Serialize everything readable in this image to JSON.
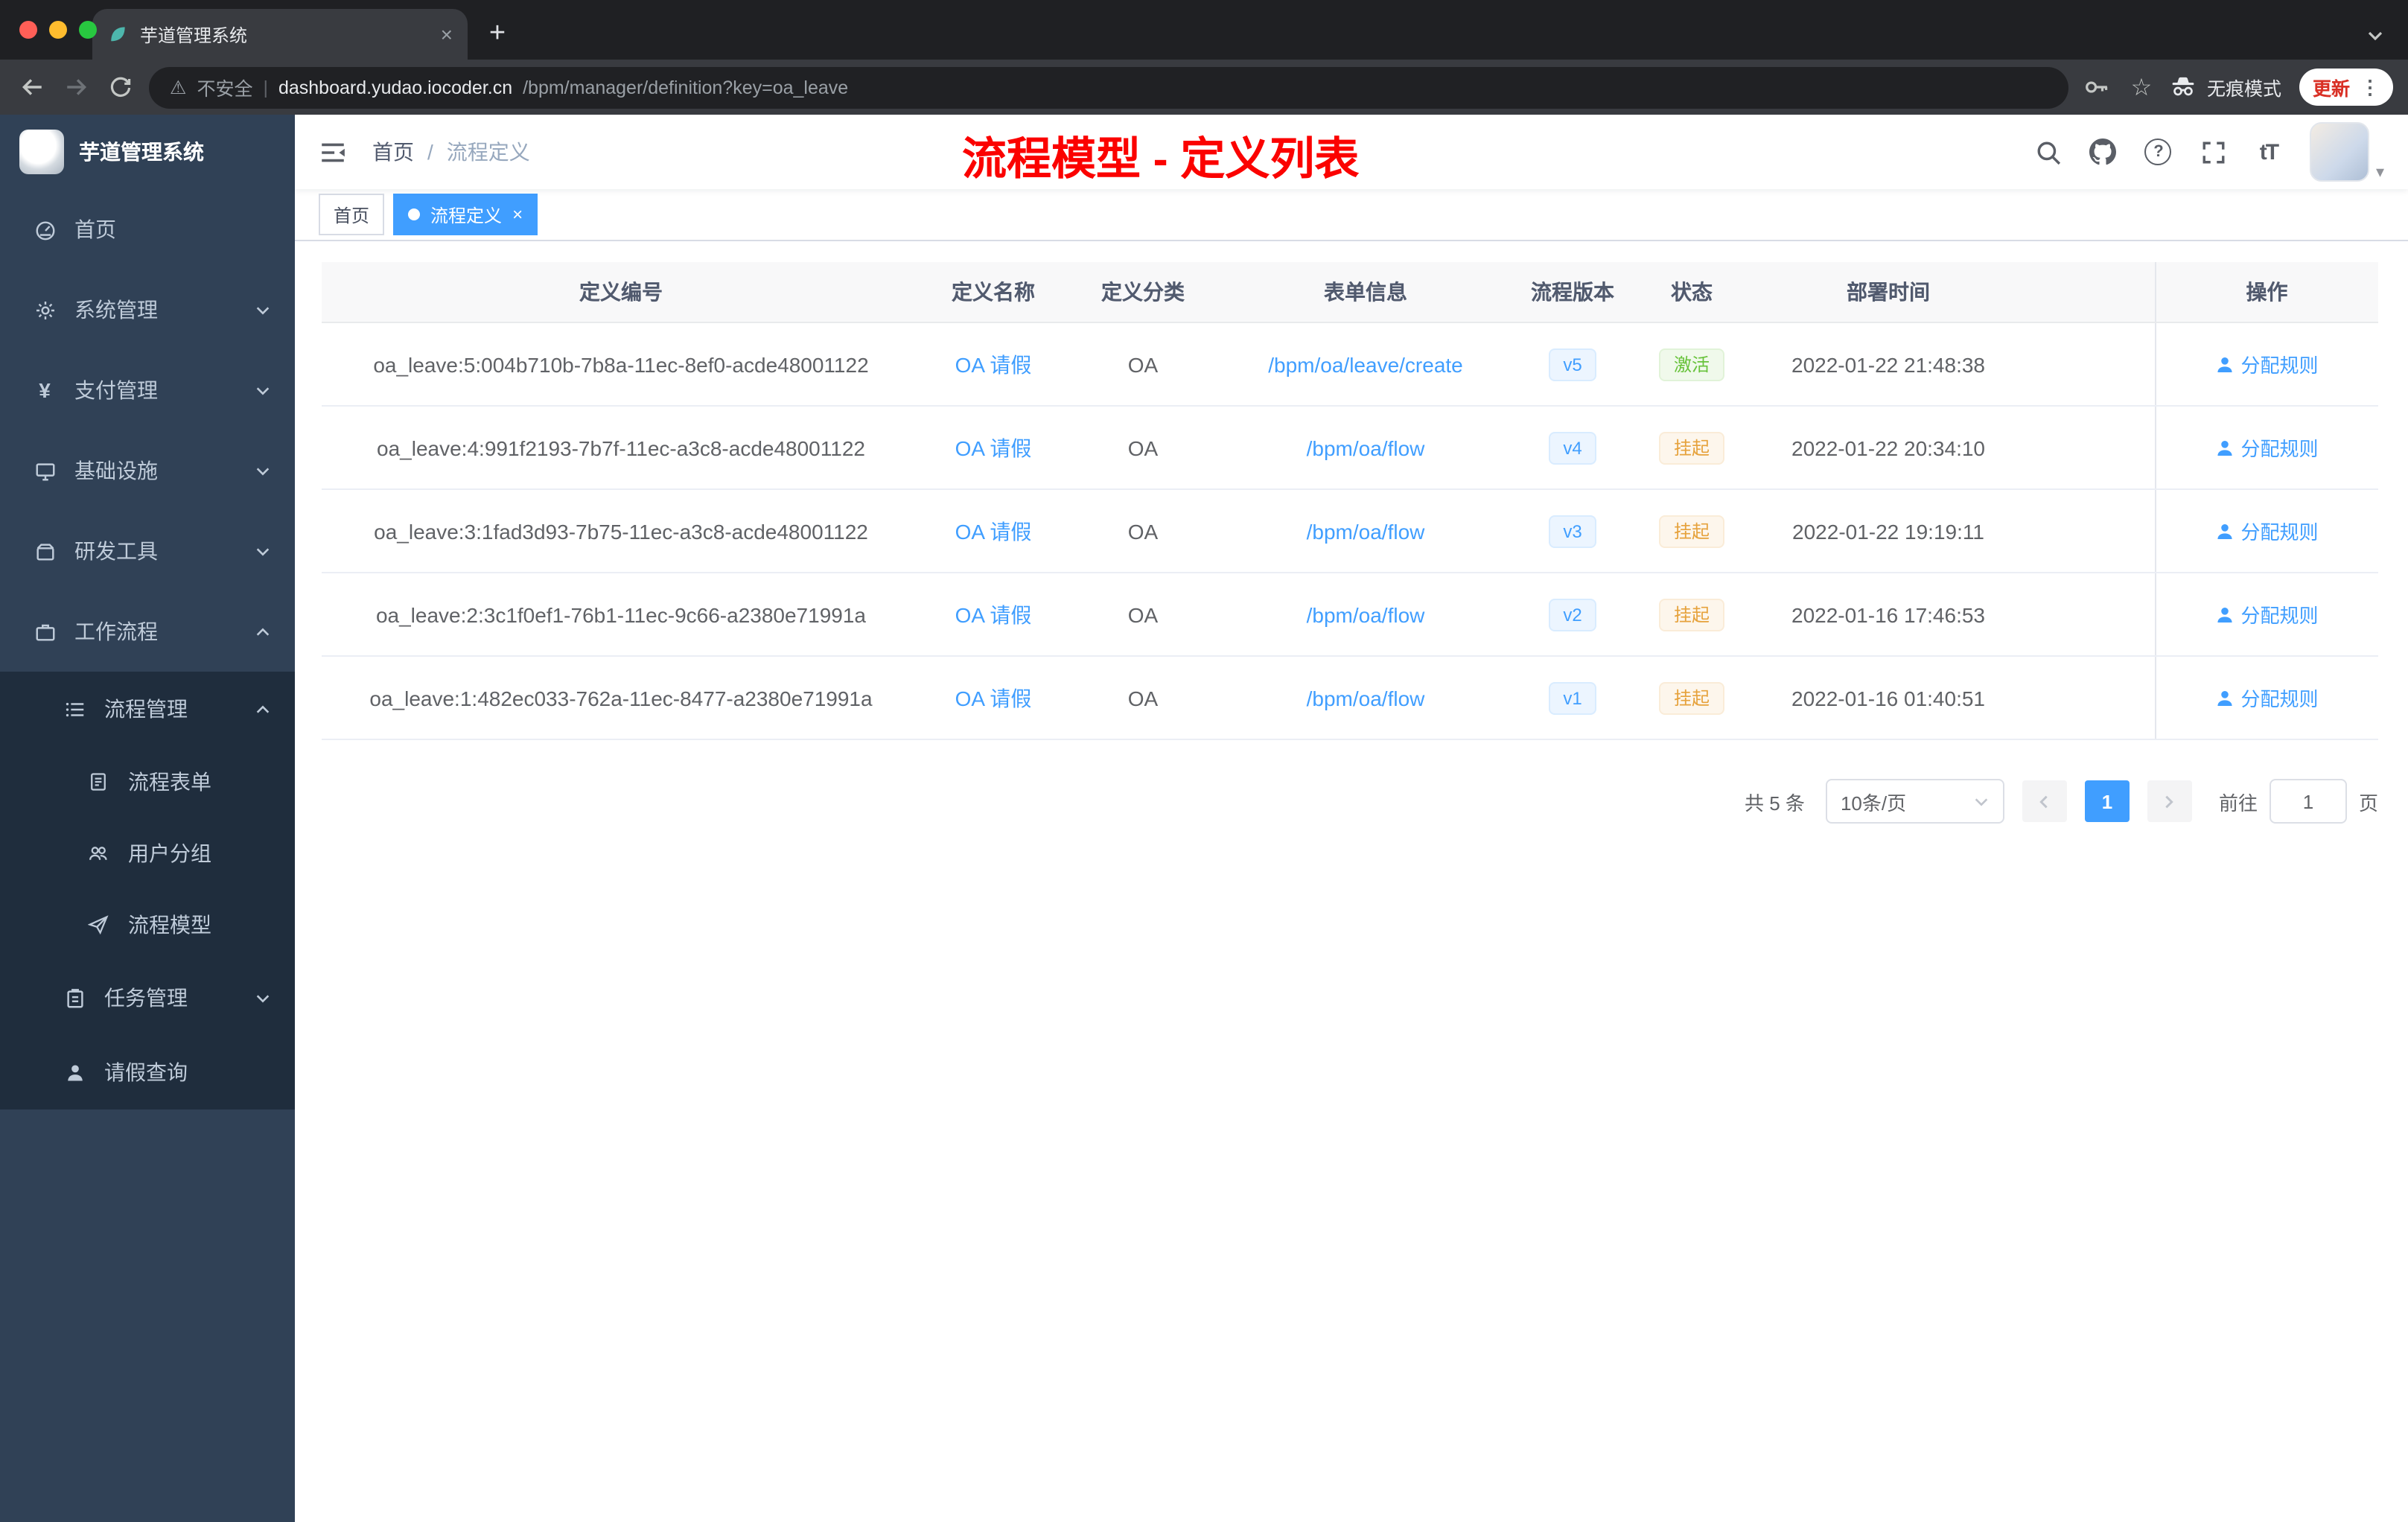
{
  "colors": {
    "accent": "#409eff",
    "success": "#67c23a",
    "warning": "#e6a23c",
    "annotation_red": "#fb0200",
    "sidebar_bg": "#304156",
    "sidebar_submenu_bg": "#1f2d3d"
  },
  "browser": {
    "tab_title": "芋道管理系统",
    "security_label": "不安全",
    "url_host": "dashboard.yudao.iocoder.cn",
    "url_path": "/bpm/manager/definition?key=oa_leave",
    "incognito_label": "无痕模式",
    "update_label": "更新"
  },
  "glyphs": {
    "tab_close": "×",
    "new_tab": "+",
    "bookmark_star": "☆",
    "menu_dots": "⋮",
    "warning_triangle": "⚠",
    "url_divider": "|",
    "breadcrumb_separator": "/",
    "tag_close": "×",
    "avatar_caret": "▾",
    "font_size_icon": "tT",
    "question_mark": "?"
  },
  "sidebar": {
    "logo_title": "芋道管理系统",
    "items": [
      {
        "label": "首页"
      },
      {
        "label": "系统管理"
      },
      {
        "label": "支付管理"
      },
      {
        "label": "基础设施"
      },
      {
        "label": "研发工具"
      },
      {
        "label": "工作流程"
      },
      {
        "label": "流程管理"
      },
      {
        "label": "流程表单"
      },
      {
        "label": "用户分组"
      },
      {
        "label": "流程模型"
      },
      {
        "label": "任务管理"
      },
      {
        "label": "请假查询"
      }
    ]
  },
  "header": {
    "breadcrumb_home": "首页",
    "breadcrumb_current": "流程定义",
    "annotation": "流程模型 - 定义列表"
  },
  "tags": [
    {
      "label": "首页"
    },
    {
      "label": "流程定义"
    }
  ],
  "table": {
    "columns": [
      "定义编号",
      "定义名称",
      "定义分类",
      "表单信息",
      "流程版本",
      "状态",
      "部署时间",
      "操作"
    ],
    "action_label": "分配规则",
    "rows": [
      {
        "id": "oa_leave:5:004b710b-7b8a-11ec-8ef0-acde48001122",
        "name": "OA 请假",
        "category": "OA",
        "form": "/bpm/oa/leave/create",
        "version": "v5",
        "status": "激活",
        "time": "2022-01-22 21:48:38"
      },
      {
        "id": "oa_leave:4:991f2193-7b7f-11ec-a3c8-acde48001122",
        "name": "OA 请假",
        "category": "OA",
        "form": "/bpm/oa/flow",
        "version": "v4",
        "status": "挂起",
        "time": "2022-01-22 20:34:10"
      },
      {
        "id": "oa_leave:3:1fad3d93-7b75-11ec-a3c8-acde48001122",
        "name": "OA 请假",
        "category": "OA",
        "form": "/bpm/oa/flow",
        "version": "v3",
        "status": "挂起",
        "time": "2022-01-22 19:19:11"
      },
      {
        "id": "oa_leave:2:3c1f0ef1-76b1-11ec-9c66-a2380e71991a",
        "name": "OA 请假",
        "category": "OA",
        "form": "/bpm/oa/flow",
        "version": "v2",
        "status": "挂起",
        "time": "2022-01-16 17:46:53"
      },
      {
        "id": "oa_leave:1:482ec033-762a-11ec-8477-a2380e71991a",
        "name": "OA 请假",
        "category": "OA",
        "form": "/bpm/oa/flow",
        "version": "v1",
        "status": "挂起",
        "time": "2022-01-16 01:40:51"
      }
    ]
  },
  "pagination": {
    "total": "共 5 条",
    "page_size": "10条/页",
    "current_page": "1",
    "goto_label": "前往",
    "goto_value": "1",
    "page_unit": "页"
  }
}
